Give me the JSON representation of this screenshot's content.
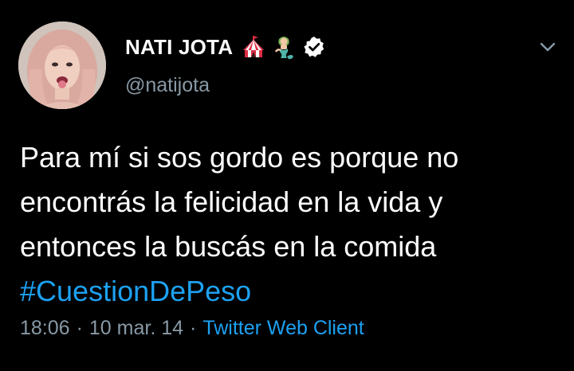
{
  "tweet": {
    "author": {
      "display_name": "NATI JOTA",
      "handle": "@natijota",
      "emojis": [
        "circus-tent-icon",
        "mermaid-icon"
      ],
      "verified": true,
      "verified_icon": "verified-badge-icon"
    },
    "menu_icon": "chevron-down-icon",
    "text_lines": [
      "Para mí si sos gordo es porque no",
      "encontrás la felicidad en la vida y",
      "entonces la buscás en la comida"
    ],
    "hashtag": "#CuestionDePeso",
    "time": "18:06",
    "date": "10 mar. 14",
    "separator": "·",
    "source": "Twitter Web Client"
  },
  "colors": {
    "background": "#000000",
    "text": "#ffffff",
    "secondary": "#8899a6",
    "link": "#1da1f2"
  }
}
